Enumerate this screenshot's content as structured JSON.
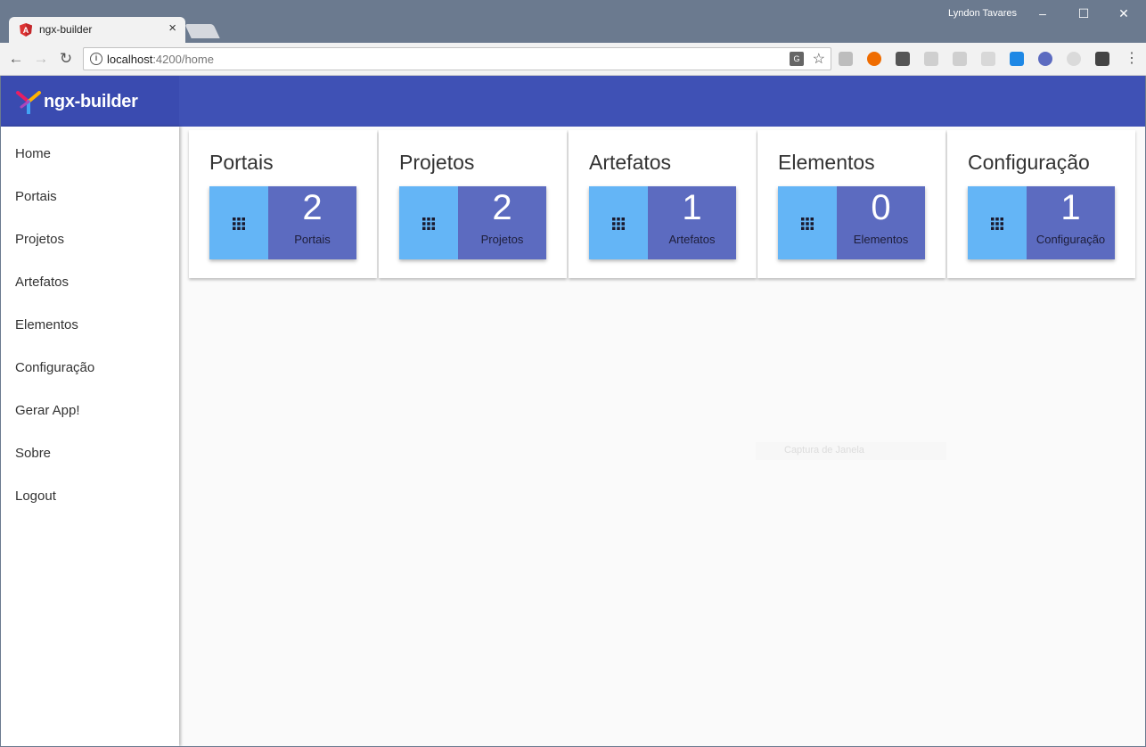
{
  "browser": {
    "tab_title": "ngx-builder",
    "tab_close": "×",
    "user_name": "Lyndon Tavares",
    "address_host": "localhost",
    "address_path": ":4200/home",
    "menu_glyph": "⋮",
    "window_controls": {
      "minimize": "–",
      "maximize": "☐",
      "close": "✕"
    }
  },
  "app": {
    "brand_name": "ngx-builder",
    "colors": {
      "header": "#3f51b5",
      "tile_left": "#64b5f6",
      "tile_right": "#5c6bc0"
    },
    "nav": [
      {
        "label": "Home"
      },
      {
        "label": "Portais"
      },
      {
        "label": "Projetos"
      },
      {
        "label": "Artefatos"
      },
      {
        "label": "Elementos"
      },
      {
        "label": "Configuração"
      },
      {
        "label": "Gerar App!"
      },
      {
        "label": "Sobre"
      },
      {
        "label": "Logout"
      }
    ],
    "cards": [
      {
        "title": "Portais",
        "count": "2",
        "label": "Portais",
        "icon": "apps-grid-icon"
      },
      {
        "title": "Projetos",
        "count": "2",
        "label": "Projetos",
        "icon": "apps-grid-icon"
      },
      {
        "title": "Artefatos",
        "count": "1",
        "label": "Artefatos",
        "icon": "apps-grid-icon"
      },
      {
        "title": "Elementos",
        "count": "0",
        "label": "Elementos",
        "icon": "apps-grid-icon"
      },
      {
        "title": "Configuração",
        "count": "1",
        "label": "Configuração",
        "icon": "apps-grid-icon"
      }
    ],
    "overlay_tooltip": "Captura de Janela"
  }
}
